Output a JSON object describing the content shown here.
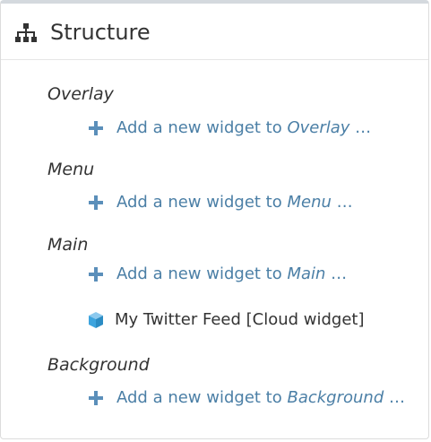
{
  "header": {
    "title": "Structure",
    "icon": "sitemap-icon"
  },
  "colors": {
    "link": "#4b7fa6",
    "plus": "#5b8fba",
    "cube": "#3da4de",
    "text": "#333333",
    "panel_border_top": "#d4d9de"
  },
  "sections": [
    {
      "title": "Overlay",
      "add_prefix": "Add a new widget to ",
      "add_target": "Overlay",
      "add_suffix": " …"
    },
    {
      "title": "Menu",
      "add_prefix": "Add a new widget to ",
      "add_target": "Menu",
      "add_suffix": " …"
    },
    {
      "title": "Main",
      "add_prefix": "Add a new widget to ",
      "add_target": "Main",
      "add_suffix": " …",
      "widgets": [
        {
          "label": "My Twitter Feed [Cloud widget]",
          "icon": "cube-icon"
        }
      ]
    },
    {
      "title": "Background",
      "add_prefix": "Add a new widget to ",
      "add_target": "Background",
      "add_suffix": " …"
    }
  ]
}
